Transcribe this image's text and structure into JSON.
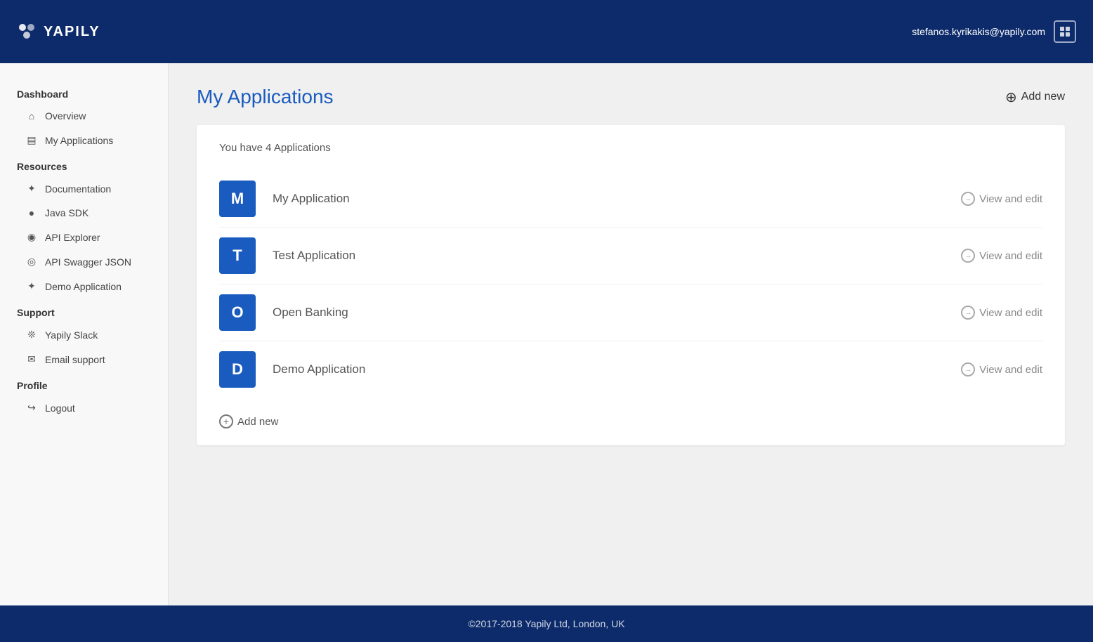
{
  "header": {
    "logo_text": "YAPILY",
    "user_email": "stefanos.kyrikakis@yapily.com"
  },
  "sidebar": {
    "sections": [
      {
        "label": "Dashboard",
        "items": [
          {
            "id": "overview",
            "label": "Overview",
            "icon": "⌂"
          },
          {
            "id": "my-applications",
            "label": "My Applications",
            "icon": "▤"
          }
        ]
      },
      {
        "label": "Resources",
        "items": [
          {
            "id": "documentation",
            "label": "Documentation",
            "icon": "✦"
          },
          {
            "id": "java-sdk",
            "label": "Java SDK",
            "icon": "●"
          },
          {
            "id": "api-explorer",
            "label": "API Explorer",
            "icon": "◉"
          },
          {
            "id": "api-swagger",
            "label": "API Swagger JSON",
            "icon": "◎"
          },
          {
            "id": "demo-application",
            "label": "Demo Application",
            "icon": "✦"
          }
        ]
      },
      {
        "label": "Support",
        "items": [
          {
            "id": "yapily-slack",
            "label": "Yapily Slack",
            "icon": "❊"
          },
          {
            "id": "email-support",
            "label": "Email support",
            "icon": "✉"
          }
        ]
      },
      {
        "label": "Profile",
        "items": [
          {
            "id": "logout",
            "label": "Logout",
            "icon": "↪"
          }
        ]
      }
    ]
  },
  "main": {
    "page_title": "My Applications",
    "add_new_label": "Add new",
    "apps_count_text": "You have 4 Applications",
    "applications": [
      {
        "id": "my-app",
        "initial": "M",
        "name": "My Application"
      },
      {
        "id": "test-app",
        "initial": "T",
        "name": "Test Application"
      },
      {
        "id": "open-banking",
        "initial": "O",
        "name": "Open Banking"
      },
      {
        "id": "demo-app",
        "initial": "D",
        "name": "Demo Application"
      }
    ],
    "view_edit_label": "View and edit",
    "add_new_bottom_label": "Add new"
  },
  "footer": {
    "text": "©2017-2018 Yapily Ltd, London, UK"
  }
}
